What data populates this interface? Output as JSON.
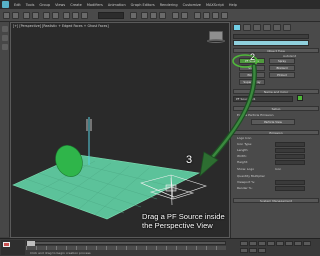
{
  "menubar": {
    "items": [
      "Edit",
      "Tools",
      "Group",
      "Views",
      "Create",
      "Modifiers",
      "Animation",
      "Graph Editors",
      "Rendering",
      "Customize",
      "MAXScript",
      "Help"
    ]
  },
  "viewport": {
    "label": "[+] [Perspective] [Realistic + Edged Faces + Ghost Faces]"
  },
  "callouts": {
    "step2": "2",
    "step3": "3"
  },
  "instruction": {
    "line1": "Drag a PF Source inside",
    "line2": "the Perspective View"
  },
  "panel": {
    "object_type_rollout": "Object Type",
    "autogrid_label": "AutoGrid",
    "buttons": [
      "PF Source",
      "Spray",
      "Snow",
      "Blizzard",
      "PArray",
      "PCloud",
      "Super Spray"
    ],
    "name_color_rollout": "Name and Color",
    "name_value": "PF Source 01",
    "setup_rollout": "Setup",
    "enable_label": "Enable Particle Emission",
    "particle_view_button": "Particle View",
    "emission_rollout": "Emission",
    "logo_icon_label": "Logo Icon",
    "icon_type_label": "Icon Type:",
    "length_label": "Length:",
    "width_label": "Width:",
    "height_label": "Height:",
    "show_logo_label": "Show: Logo",
    "show_icon_label": "Icon",
    "quantity_label": "Quantity Multiplier",
    "viewport_pct_label": "Viewport %:",
    "render_pct_label": "Render %:",
    "system_mgmt_rollout": "System Management"
  },
  "status": {
    "text": "Click and drag to begin creation process"
  },
  "colors": {
    "accent": "#4fb83a",
    "grid_plane": "#5cc29a",
    "sphere": "#2fb54a",
    "panel_highlight": "#71cfe6",
    "arrow": "#215e29"
  },
  "icons": [
    "app-logo-icon",
    "maxscript-icon",
    "viewcube-icon",
    "play-icon"
  ]
}
